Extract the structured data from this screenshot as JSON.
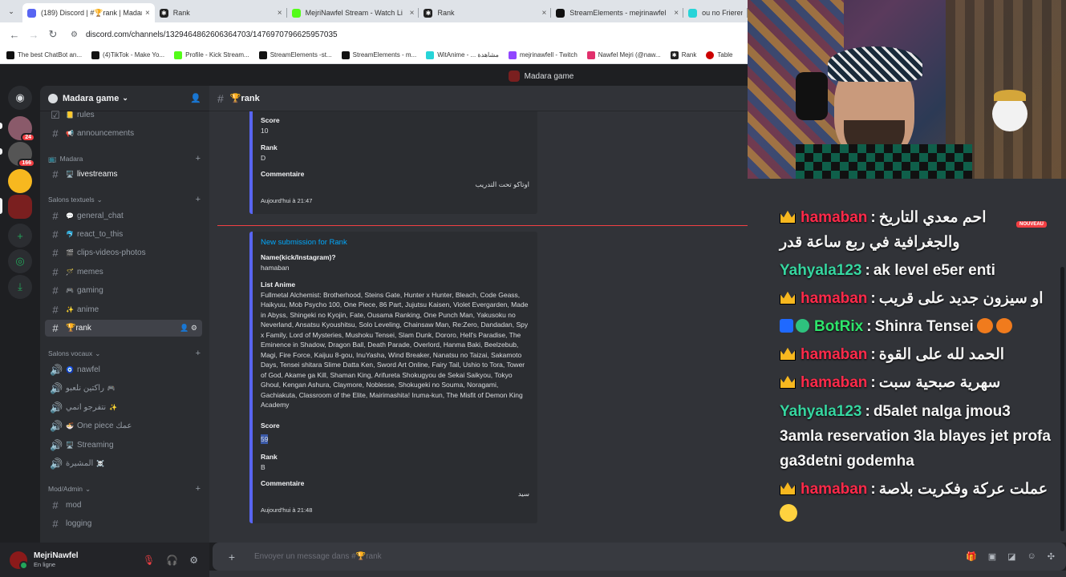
{
  "browser": {
    "tabs": [
      {
        "title": "(189) Discord | #🏆rank | Madara",
        "color": "#5865f2",
        "active": true
      },
      {
        "title": "Rank",
        "color": "#222222"
      },
      {
        "title": "MejriNawfel Stream - Watch Li",
        "color": "#53fc18"
      },
      {
        "title": "Rank",
        "color": "#222222"
      },
      {
        "title": "StreamElements - mejrinawfel",
        "color": "#111111"
      },
      {
        "title": "ou no Frieren 2",
        "color": "#27d4d8"
      }
    ],
    "url": "discord.com/channels/1329464862606364703/1476970796625957035",
    "bookmarks": [
      {
        "label": "The best ChatBot an...",
        "color": "#111111"
      },
      {
        "label": "(4)TikTok - Make Yo...",
        "color": "#111111"
      },
      {
        "label": "Profile - Kick Stream...",
        "color": "#53fc18"
      },
      {
        "label": "StreamElements -st...",
        "color": "#111111"
      },
      {
        "label": "StreamElements - m...",
        "color": "#111111"
      },
      {
        "label": "WitAnime - ... مشاهدة",
        "color": "#27d4d8"
      },
      {
        "label": "mejrinawfell - Twitch",
        "color": "#9146ff"
      },
      {
        "label": "Nawfel Mejri (@naw...",
        "color": "#e1306c"
      },
      {
        "label": "Rank",
        "color": "#222222"
      },
      {
        "label": "Table",
        "color": "#cc0000"
      }
    ]
  },
  "discord": {
    "title": "Madara game",
    "guild_name": "Madara game",
    "server_badges": [
      "24",
      "166"
    ],
    "channels_top": [
      {
        "name": "rules",
        "emoji": "📒"
      },
      {
        "name": "announcements",
        "emoji": "📢"
      }
    ],
    "cat_madara": "Madara",
    "livestreams": "livestreams",
    "cat_textuels": "Salons textuels",
    "text_channels": [
      {
        "name": "general_chat",
        "emoji": "💬"
      },
      {
        "name": "react_to_this",
        "emoji": "🐬"
      },
      {
        "name": "clips-videos-photos",
        "emoji": "🎬"
      },
      {
        "name": "memes",
        "emoji": "🪄"
      },
      {
        "name": "gaming",
        "emoji": "🎮"
      },
      {
        "name": "anime",
        "emoji": "✨"
      }
    ],
    "active_channel": "🏆rank",
    "cat_vocaux": "Salons vocaux",
    "voice_channels": [
      {
        "name": "nawfel",
        "emoji": "🧿"
      },
      {
        "name": "راكتين نلعبو",
        "emoji": "🎮"
      },
      {
        "name": "نتفرجو انمي",
        "emoji": "✨"
      },
      {
        "name": "One piece عمك",
        "emoji": "🍜"
      },
      {
        "name": "Streaming",
        "emoji": "🖥️"
      },
      {
        "name": "المشيرة",
        "emoji": "☠️"
      }
    ],
    "cat_modadmin": "Mod/Admin",
    "mod_channels": [
      "mod",
      "logging"
    ],
    "user": {
      "name": "MejriNawfel",
      "status": "En ligne"
    },
    "channel_header": "🏆rank",
    "composer_placeholder": "Envoyer un message dans #🏆rank",
    "embed1": {
      "score_label": "Score",
      "score": "10",
      "rank_label": "Rank",
      "rank": "D",
      "comment_label": "Commentaire",
      "comment": "اوتاكو تحت التدريب",
      "footer": "Aujourd'hui à 21:47"
    },
    "embed2": {
      "title": "New submission for Rank",
      "name_label": "Name(kick/Instagram)?",
      "name": "hamaban",
      "list_label": "List Anime",
      "list": "Fullmetal Alchemist: Brotherhood, Steins Gate, Hunter x Hunter, Bleach, Code Geass, Haikyuu, Mob Psycho 100, One Piece, 86 Part, Jujutsu Kaisen, Violet Evergarden, Made in Abyss, Shingeki no Kyojin, Fate, Ousama Ranking, One Punch Man, Yakusoku no Neverland, Ansatsu Kyoushitsu, Solo Leveling, Chainsaw Man, Re:Zero, Dandadan, Spy x Family, Lord of Mysteries, Mushoku Tensei, Slam Dunk, Dororo, Hell's Paradise, The Eminence in Shadow, Dragon Ball, Death Parade, Overlord, Hanma Baki, Beelzebub, Magi, Fire Force, Kaijuu 8-gou, InuYasha, Wind Breaker, Nanatsu no Taizai, Sakamoto Days, Tensei shitara Slime Datta Ken, Sword Art Online, Fairy Tail, Ushio to Tora, Tower of God, Akame ga Kill, Shaman King, Arifureta Shokugyou de Sekai Saikyou, Tokyo Ghoul, Kengan Ashura, Claymore, Noblesse, Shokugeki no Souma, Noragami, Gachiakuta, Classroom of the Elite, Mairimashita! Iruma-kun, The Misfit of Demon King Academy",
      "score_label": "Score",
      "score": "59",
      "rank_label": "Rank",
      "rank": "B",
      "comment_label": "Commentaire",
      "comment": "سيد",
      "footer": "Aujourd'hui à 21:48"
    }
  },
  "stream_chat": {
    "nouveau": "NOUVEAU",
    "messages": [
      {
        "user": "hamaban",
        "color": "#ff2a4a",
        "text": "احم معدي التاريخ والجغرافية في ربع ساعة قدر",
        "badge": "crown"
      },
      {
        "user": "Yahyala123",
        "color": "#36d6a0",
        "text": "ak level e5er enti",
        "badge": "none"
      },
      {
        "user": "hamaban",
        "color": "#ff2a4a",
        "text": "او سيزون جديد على قريب",
        "badge": "crown"
      },
      {
        "user": "BotRix",
        "color": "#2ee56b",
        "text": "Shinra Tensei",
        "badge": "bot"
      },
      {
        "user": "hamaban",
        "color": "#ff2a4a",
        "text": "الحمد لله على القوة",
        "badge": "crown"
      },
      {
        "user": "hamaban",
        "color": "#ff2a4a",
        "text": "سهرية صبحية سبت",
        "badge": "crown"
      },
      {
        "user": "Yahyala123",
        "color": "#36d6a0",
        "text": "d5alet nalga jmou3 3amla reservation 3la blayes jet profa ga3detni godemha",
        "badge": "none"
      },
      {
        "user": "hamaban",
        "color": "#ff2a4a",
        "text": "عملت عركة وفكريت بلاصة",
        "badge": "crown"
      }
    ]
  }
}
